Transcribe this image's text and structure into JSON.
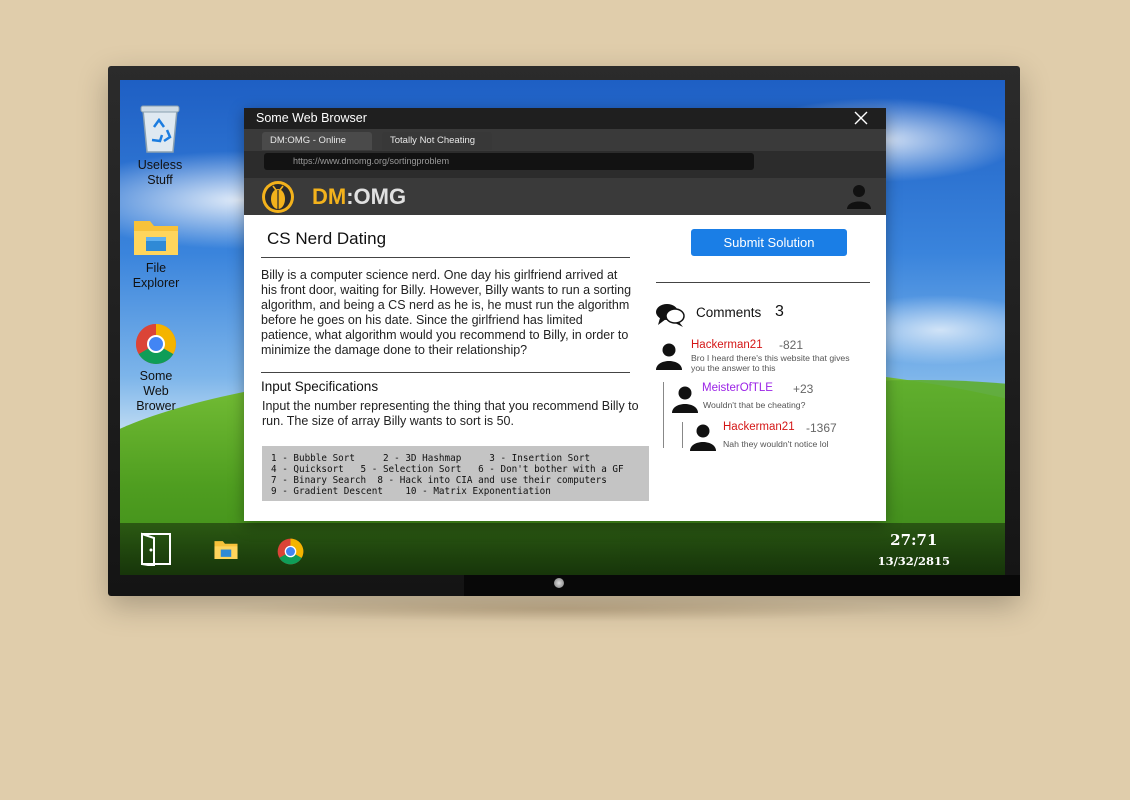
{
  "desktop": {
    "icons": [
      {
        "label_line1": "Useless",
        "label_line2": "Stuff",
        "icon": "recycle-bin-icon"
      },
      {
        "label_line1": "File",
        "label_line2": "Explorer",
        "icon": "folder-icon"
      },
      {
        "label_line1": "Some",
        "label_line2": "Web",
        "label_line3": "Brower",
        "icon": "chrome-icon"
      }
    ],
    "clock": {
      "time": "27:71",
      "date": "13/32/2815"
    }
  },
  "browser": {
    "title": "Some Web Browser",
    "tabs": [
      {
        "label": "DM:OMG - Online gr..."
      },
      {
        "label": "Totally Not Cheating"
      }
    ],
    "url": "https://www.dmomg.org/sortingproblem"
  },
  "site": {
    "brand_dm": "DM",
    "brand_rest": ":OMG"
  },
  "problem": {
    "title": "CS Nerd Dating",
    "statement": "Billy is a computer science nerd. One day his girlfriend arrived at his front door, waiting for Billy. However, Billy wants to run a sorting algorithm, and being a CS nerd as he is, he must run the algorithm before he goes on his date. Since the girlfriend has limited patience, what algorithm would you recommend to Billy, in order to minimize the damage done to their relationship?",
    "spec_heading": "Input Specifications",
    "spec_text": "Input the number representing the thing that you recommend Billy to run. The size of array Billy wants to sort is 50.",
    "options_lines": [
      "1 - Bubble Sort     2 - 3D Hashmap     3 - Insertion Sort",
      "4 - Quicksort   5 - Selection Sort   6 - Don't bother with a GF",
      "7 - Binary Search  8 - Hack into CIA and use their computers",
      "9 - Gradient Descent    10 - Matrix Exponentiation"
    ]
  },
  "sidebar": {
    "submit_label": "Submit Solution",
    "comments_label": "Comments",
    "comments_count": "3",
    "comments": [
      {
        "user": "Hackerman21",
        "score": "-821",
        "text": "Bro I heard there's this website that gives you the answer to this",
        "color": "#d41616"
      },
      {
        "user": "MeisterOfTLE",
        "score": "+23",
        "text": "Wouldn't that be cheating?",
        "color": "#9b23e6"
      },
      {
        "user": "Hackerman21",
        "score": "-1367",
        "text": "Nah they wouldn't notice lol",
        "color": "#d41616"
      }
    ]
  }
}
